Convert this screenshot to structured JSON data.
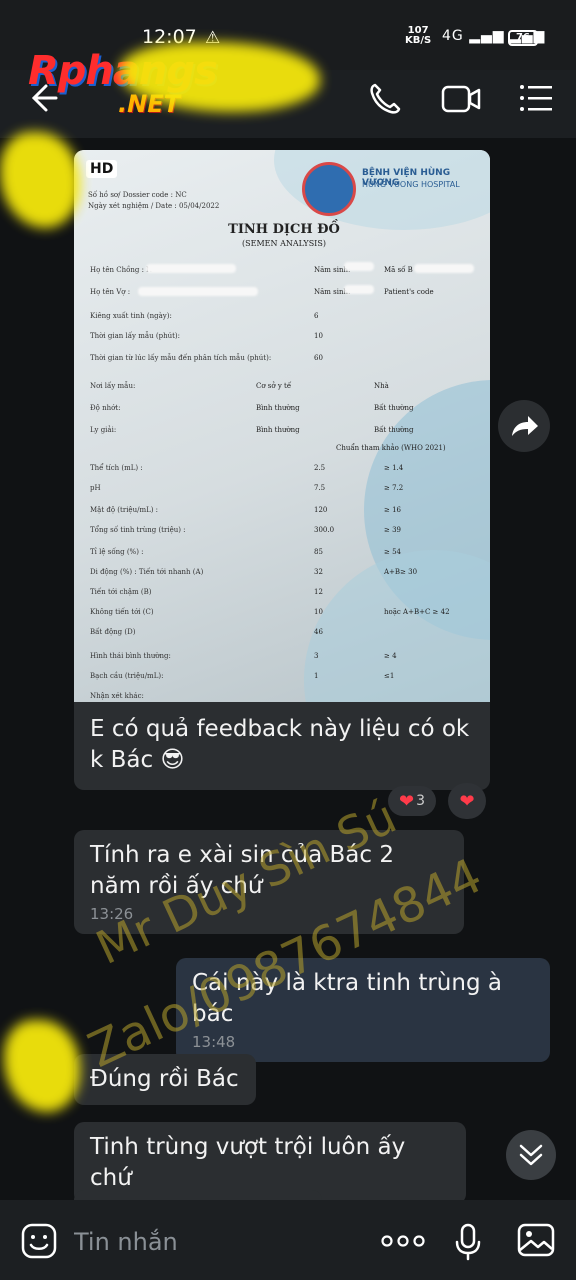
{
  "status_bar": {
    "time": "12:07",
    "net_speed_value": "107",
    "net_speed_unit": "KB/S",
    "network": "4G",
    "battery": "76"
  },
  "header": {
    "logo_top": "Rphangs",
    "logo_bottom": ".NET"
  },
  "photo": {
    "hd_label": "HD",
    "doc": {
      "hospital_name": "BỆNH VIỆN HÙNG VƯƠNG",
      "hospital_sub": "HUNG VUONG HOSPITAL",
      "dossier": "Số hồ sơ/ Dossier code :",
      "dossier_val": "NC",
      "date": "Ngày xét nghiệm / Date : 05/04/2022",
      "title": "TINH DỊCH ĐỒ",
      "subtitle": "(SEMEN ANALYSIS)",
      "rows": [
        {
          "label": "Họ tên Chồng : N",
          "val": "Năm sinh:",
          "ref": "Mã số B"
        },
        {
          "label": "Họ tên Vợ :",
          "val": "Năm sinh:",
          "ref": "Patient's code"
        },
        {
          "label": "Kiêng xuất tinh (ngày):",
          "val": "6",
          "ref": ""
        },
        {
          "label": "Thời gian lấy mẫu (phút):",
          "val": "10",
          "ref": ""
        },
        {
          "label": "Thời gian từ lúc lấy mẫu đến phân tích mẫu (phút):",
          "val": "60",
          "ref": ""
        },
        {
          "label": "Nơi lấy mẫu:",
          "val": "Cơ sở y tế",
          "ref": "Nhà"
        },
        {
          "label": "Độ nhớt:",
          "val": "Bình thường",
          "ref": "Bất thường"
        },
        {
          "label": "Ly giải:",
          "val": "Bình thường",
          "ref": "Bất thường"
        },
        {
          "label": "",
          "val": "Chuẩn tham khảo (WHO 2021)",
          "ref": ""
        },
        {
          "label": "Thể tích (mL) :",
          "val": "2.5",
          "ref": "≥ 1.4"
        },
        {
          "label": "pH",
          "val": "7.5",
          "ref": "≥ 7.2"
        },
        {
          "label": "Mật độ (triệu/mL) :",
          "val": "120",
          "ref": "≥ 16"
        },
        {
          "label": "Tổng số tinh trùng (triệu) :",
          "val": "300.0",
          "ref": "≥ 39"
        },
        {
          "label": "Tỉ lệ sống (%) :",
          "val": "85",
          "ref": "≥ 54"
        },
        {
          "label": "Di động (%) :  Tiến tới nhanh (A)",
          "val": "32",
          "ref": "A+B≥ 30"
        },
        {
          "label": "Tiến tới chậm (B)",
          "val": "12",
          "ref": ""
        },
        {
          "label": "Không tiến tới (C)",
          "val": "10",
          "ref": "hoặc A+B+C ≥ 42"
        },
        {
          "label": "Bất động (D)",
          "val": "46",
          "ref": ""
        },
        {
          "label": "Hình thái bình thường:",
          "val": "3",
          "ref": "≥ 4"
        },
        {
          "label": "Bạch cầu (triệu/mL):",
          "val": "1",
          "ref": "≤1"
        },
        {
          "label": "Nhận xét khác:",
          "val": "",
          "ref": ""
        }
      ]
    }
  },
  "messages": [
    {
      "text": "E có quả feedback này liệu có ok k Bác 😎",
      "time": ""
    },
    {
      "text": "Tính ra e xài sin của Bác 2 năm rồi ấy chứ",
      "time": "13:26"
    },
    {
      "text": "Cái này là ktra tinh trùng à bác",
      "time": "13:48"
    },
    {
      "text": "Đúng rồi Bác",
      "time": ""
    },
    {
      "text": "Tinh trùng vượt trội luôn ấy chứ",
      "time": ""
    }
  ],
  "reactions": {
    "count": "3"
  },
  "watermark": {
    "line1": "Mr Duy Sìn Sú",
    "line2": "Zalo/0987674844"
  },
  "composer": {
    "placeholder": "Tin nhắn"
  },
  "colors": {
    "highlight_yellow": "#f4e70c",
    "bubble": "#2b2e31",
    "own_bubble": "#2a3442",
    "heart": "#ff3b4a"
  }
}
